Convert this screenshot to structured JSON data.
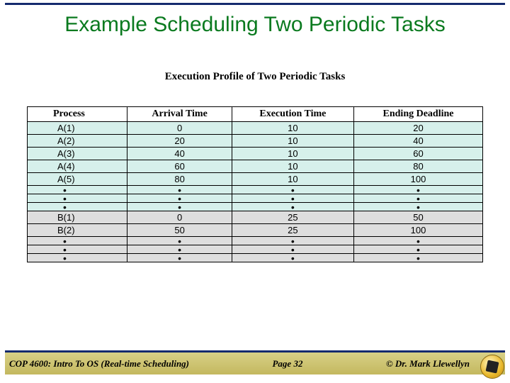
{
  "title": "Example Scheduling Two Periodic Tasks",
  "subtitle": "Execution Profile of Two Periodic Tasks",
  "headers": {
    "process": "Process",
    "arrival": "Arrival Time",
    "exec": "Execution Time",
    "deadline": "Ending Deadline"
  },
  "rowsA": [
    {
      "p": "A(1)",
      "a": "0",
      "e": "10",
      "d": "20"
    },
    {
      "p": "A(2)",
      "a": "20",
      "e": "10",
      "d": "40"
    },
    {
      "p": "A(3)",
      "a": "40",
      "e": "10",
      "d": "60"
    },
    {
      "p": "A(4)",
      "a": "60",
      "e": "10",
      "d": "80"
    },
    {
      "p": "A(5)",
      "a": "80",
      "e": "10",
      "d": "100"
    }
  ],
  "rowsB": [
    {
      "p": "B(1)",
      "a": "0",
      "e": "25",
      "d": "50"
    },
    {
      "p": "B(2)",
      "a": "50",
      "e": "25",
      "d": "100"
    }
  ],
  "dot": "•",
  "footer": {
    "left": "COP 4600: Intro To OS  (Real-time Scheduling)",
    "mid": "Page 32",
    "right": "© Dr. Mark Llewellyn"
  },
  "chart_data": {
    "type": "table",
    "title": "Execution Profile of Two Periodic Tasks",
    "columns": [
      "Process",
      "Arrival Time",
      "Execution Time",
      "Ending Deadline"
    ],
    "rows": [
      [
        "A(1)",
        0,
        10,
        20
      ],
      [
        "A(2)",
        20,
        10,
        40
      ],
      [
        "A(3)",
        40,
        10,
        60
      ],
      [
        "A(4)",
        60,
        10,
        80
      ],
      [
        "A(5)",
        80,
        10,
        100
      ],
      [
        "B(1)",
        0,
        25,
        50
      ],
      [
        "B(2)",
        50,
        25,
        100
      ]
    ]
  }
}
